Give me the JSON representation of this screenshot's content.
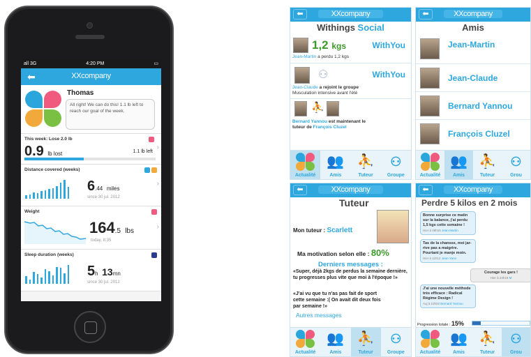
{
  "phone": {
    "status": {
      "carrier": "all 3G",
      "time": "4:20 PM"
    },
    "nav_title": "XXcompany",
    "profile": {
      "name": "Thomas",
      "message": "All right! We can do this! 1.1 lb left to reach our goal of the week."
    },
    "week_card": {
      "label": "This week: Lose 2.0 lb",
      "value": "0.9",
      "unit": "lb lost",
      "left": "1.1 lb left",
      "progress": 0.45
    },
    "distance_card": {
      "label": "Distance covered (weeks)",
      "value": "6",
      "decimal": ".44",
      "unit": "miles",
      "since": "since 30 jul. 2012",
      "bars": [
        0.15,
        0.2,
        0.3,
        0.25,
        0.35,
        0.4,
        0.45,
        0.5,
        0.6,
        0.75,
        0.9,
        0.55
      ]
    },
    "weight_card": {
      "label": "Weight",
      "value": "164",
      "decimal": ".5",
      "unit": "lbs",
      "since": "today, 8:35"
    },
    "sleep_card": {
      "label": "Sleep duration (weeks)",
      "value": "5",
      "unit1": "h",
      "value2": "13",
      "unit2": "mn",
      "since": "since 30 jul. 2012",
      "bars": [
        0.35,
        0.2,
        0.55,
        0.45,
        0.3,
        0.7,
        0.6,
        0.4,
        0.8,
        0.75,
        0.5,
        0.9
      ]
    }
  },
  "panels": {
    "social": {
      "title_part1": "Withings",
      "title_part2": "Social",
      "post1": {
        "value": "1,2",
        "unit": "kgs",
        "brand": "WithYou",
        "author": "Jean-Martin",
        "text": "a perdu 1,2 kgs"
      },
      "post2": {
        "brand": "WithYou",
        "author": "Jean-Claude",
        "text": "a rejoint le groupe",
        "group": "Musculation intensive avant l'été"
      },
      "post3": {
        "author": "Bernard Yannou",
        "text": "est maintenant le",
        "text2": "tuteur de",
        "target": "François Cluzel"
      }
    },
    "amis": {
      "title": "Amis",
      "friends": [
        "Jean-Martin",
        "Jean-Claude",
        "Bernard Yannou",
        "François Cluzel"
      ]
    },
    "tuteur": {
      "title": "Tuteur",
      "mon_tuteur_label": "Mon tuteur :",
      "tutor_name": "Scarlett",
      "motivation_label": "Ma motivation selon elle :",
      "motivation_value": "80%",
      "messages_header": "Derniers messages :",
      "message1": "«Super, déjà 2kgs de perdus la semaine dernière, tu progresses plus vite que moi à l'époque !»",
      "message2": "«J'ai vu que tu n'as pas fait de sport cette semaine :( On avait dit deux fois par semaine !»",
      "more_link": "Autres messages"
    },
    "group": {
      "title": "Perdre 5 kilos en 2 mois",
      "msg1": {
        "text": "Bonne surprise ce matin sur la balance, j'ai perdu 1,5 kgs cette semaine !",
        "time": "Hier à 08h15",
        "author": "Jean-Martin"
      },
      "msg2": {
        "text": "Tas de la chansse, moi jar- rive pas a maigrire. Pourtant je manje moin.",
        "time": "Hier à 11h12",
        "author": "Jean-Yann"
      },
      "msg3": {
        "text": "Courage les gars !",
        "time": "Hier à 23h18",
        "author": "M"
      },
      "msg4": {
        "text": "J'ai une nouvelle méthode très efficace : Radical Régime Design !",
        "time": "Auj à 10h02",
        "author": "Bernard Yannou"
      },
      "progress_label": "Progression totale :",
      "progress_value": "15%",
      "progress": 0.15
    }
  },
  "nav_title": "XXcompany",
  "tabs": [
    "Actualité",
    "Amis",
    "Tuteur",
    "Groupe"
  ],
  "tabs_truncated": [
    "Actualité",
    "Amis",
    "Tuteur",
    "Grou"
  ],
  "colors": {
    "accent": "#2ea7df",
    "motivation": "#3d9a2a"
  }
}
